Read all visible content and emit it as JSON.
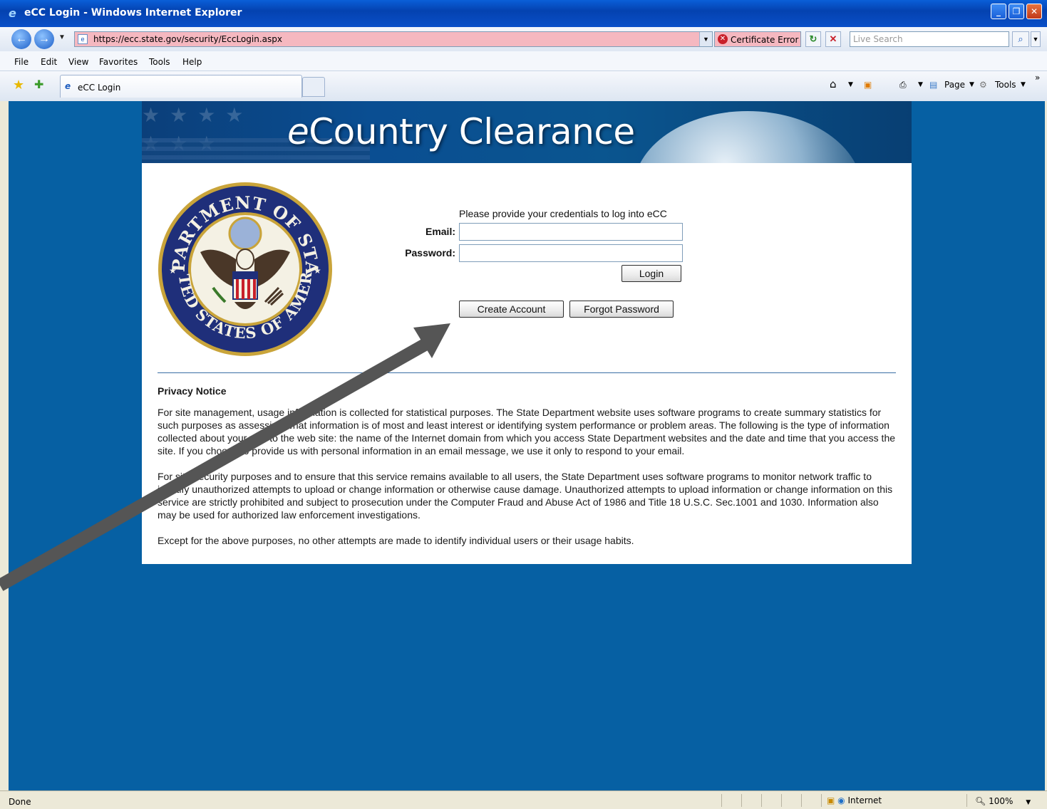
{
  "window": {
    "title": "eCC Login - Windows Internet Explorer"
  },
  "address_bar": {
    "url": "https://ecc.state.gov/security/EccLogin.aspx",
    "certificate_error": "Certificate Error",
    "search_placeholder": "Live Search"
  },
  "menu": {
    "items": [
      "File",
      "Edit",
      "View",
      "Favorites",
      "Tools",
      "Help"
    ]
  },
  "tab": {
    "label": "eCC Login"
  },
  "command_bar": {
    "page_label": "Page",
    "tools_label": "Tools"
  },
  "banner": {
    "title_prefix": "e",
    "title_rest": "Country Clearance"
  },
  "seal": {
    "top_text": "DEPARTMENT OF STATE",
    "bottom_text": "UNITED STATES OF AMERICA"
  },
  "login": {
    "prompt": "Please provide your credentials to log into eCC",
    "email_label": "Email:",
    "email_value": "",
    "password_label": "Password:",
    "password_value": "",
    "login_button": "Login",
    "create_account_button": "Create Account",
    "forgot_password_button": "Forgot Password"
  },
  "privacy": {
    "heading": "Privacy Notice",
    "paragraphs": [
      "For site management, usage information is collected for statistical purposes. The State Department website uses software programs to create summary statistics for such purposes as assessing what information is of most and least interest or identifying system performance or problem areas. The following is the type of information collected about your visit to the web site: the name of the Internet domain from which you access State Department websites and the date and time that you access the site. If you choose to provide us with personal information in an email message, we use it only to respond to your email.",
      "For site security purposes and to ensure that this service remains available to all users, the State Department uses software programs to monitor network traffic to identify unauthorized attempts to upload or change information or otherwise cause damage. Unauthorized attempts to upload information or change information on this service are strictly prohibited and subject to prosecution under the Computer Fraud and Abuse Act of 1986 and Title 18 U.S.C. Sec.1001 and 1030. Information also may be used for authorized law enforcement investigations.",
      "Except for the above purposes, no other attempts are made to identify individual users or their usage habits."
    ]
  },
  "status_bar": {
    "status": "Done",
    "zone": "Internet",
    "zoom": "100%"
  },
  "colors": {
    "page_background": "#0660a3",
    "address_error_background": "#f5b8c0",
    "divider": "#3a6ea5"
  }
}
